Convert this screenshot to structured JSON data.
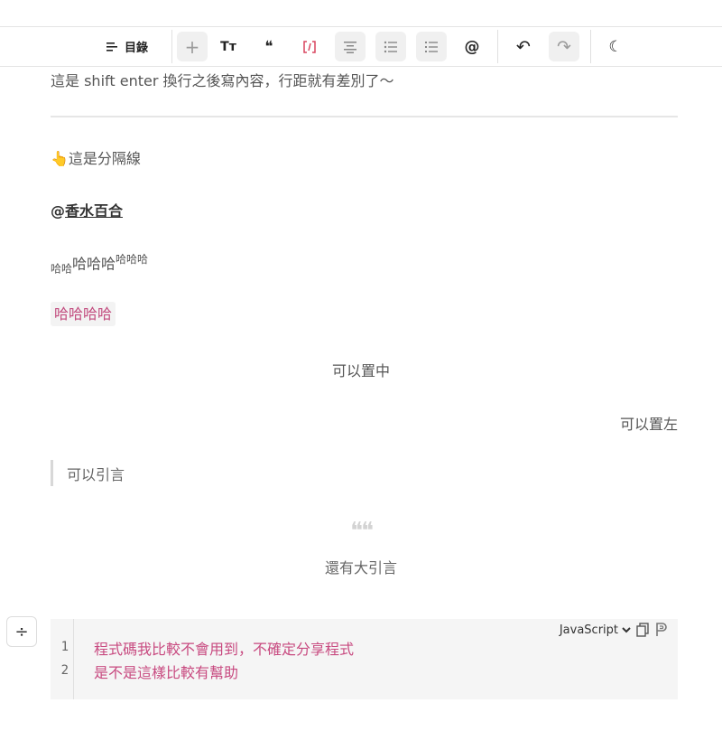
{
  "toolbar": {
    "toc_label": "目錄",
    "items": [
      {
        "name": "plus-icon",
        "glyph": "+"
      },
      {
        "name": "text-size-icon",
        "glyph": "Tт"
      },
      {
        "name": "quote-icon",
        "glyph": "❝"
      },
      {
        "name": "inline-code-icon",
        "glyph": "⦃"
      },
      {
        "name": "align-center-icon",
        "glyph": "≡"
      },
      {
        "name": "bullet-list-icon",
        "glyph": "☰"
      },
      {
        "name": "ordered-list-icon",
        "glyph": "☰"
      },
      {
        "name": "mention-icon",
        "glyph": "@"
      },
      {
        "name": "undo-icon",
        "glyph": "↶"
      },
      {
        "name": "redo-icon",
        "glyph": "↷"
      },
      {
        "name": "dark-mode-icon",
        "glyph": "☾"
      }
    ]
  },
  "content": {
    "line1": "這是 shift enter 換行之後寫內容，行距就有差別了～",
    "divider_label": "這是分隔線",
    "divider_emoji": "👆",
    "mention_at": "@",
    "mention_name": "香水百合",
    "sub_text": "哈哈",
    "normal_text": "哈哈哈",
    "sup_text": "哈哈哈",
    "highlight_text": "哈哈哈哈",
    "center_text": "可以置中",
    "right_text": "可以置左",
    "quote_text": "可以引言",
    "big_quote_mark": "❝❝",
    "big_quote_text": "還有大引言"
  },
  "code": {
    "language": "JavaScript",
    "lines": [
      "程式碼我比較不會用到，不確定分享程式",
      "是不是這樣比較有幫助"
    ],
    "line_numbers": [
      "1",
      "2"
    ]
  },
  "side_handle": "÷"
}
